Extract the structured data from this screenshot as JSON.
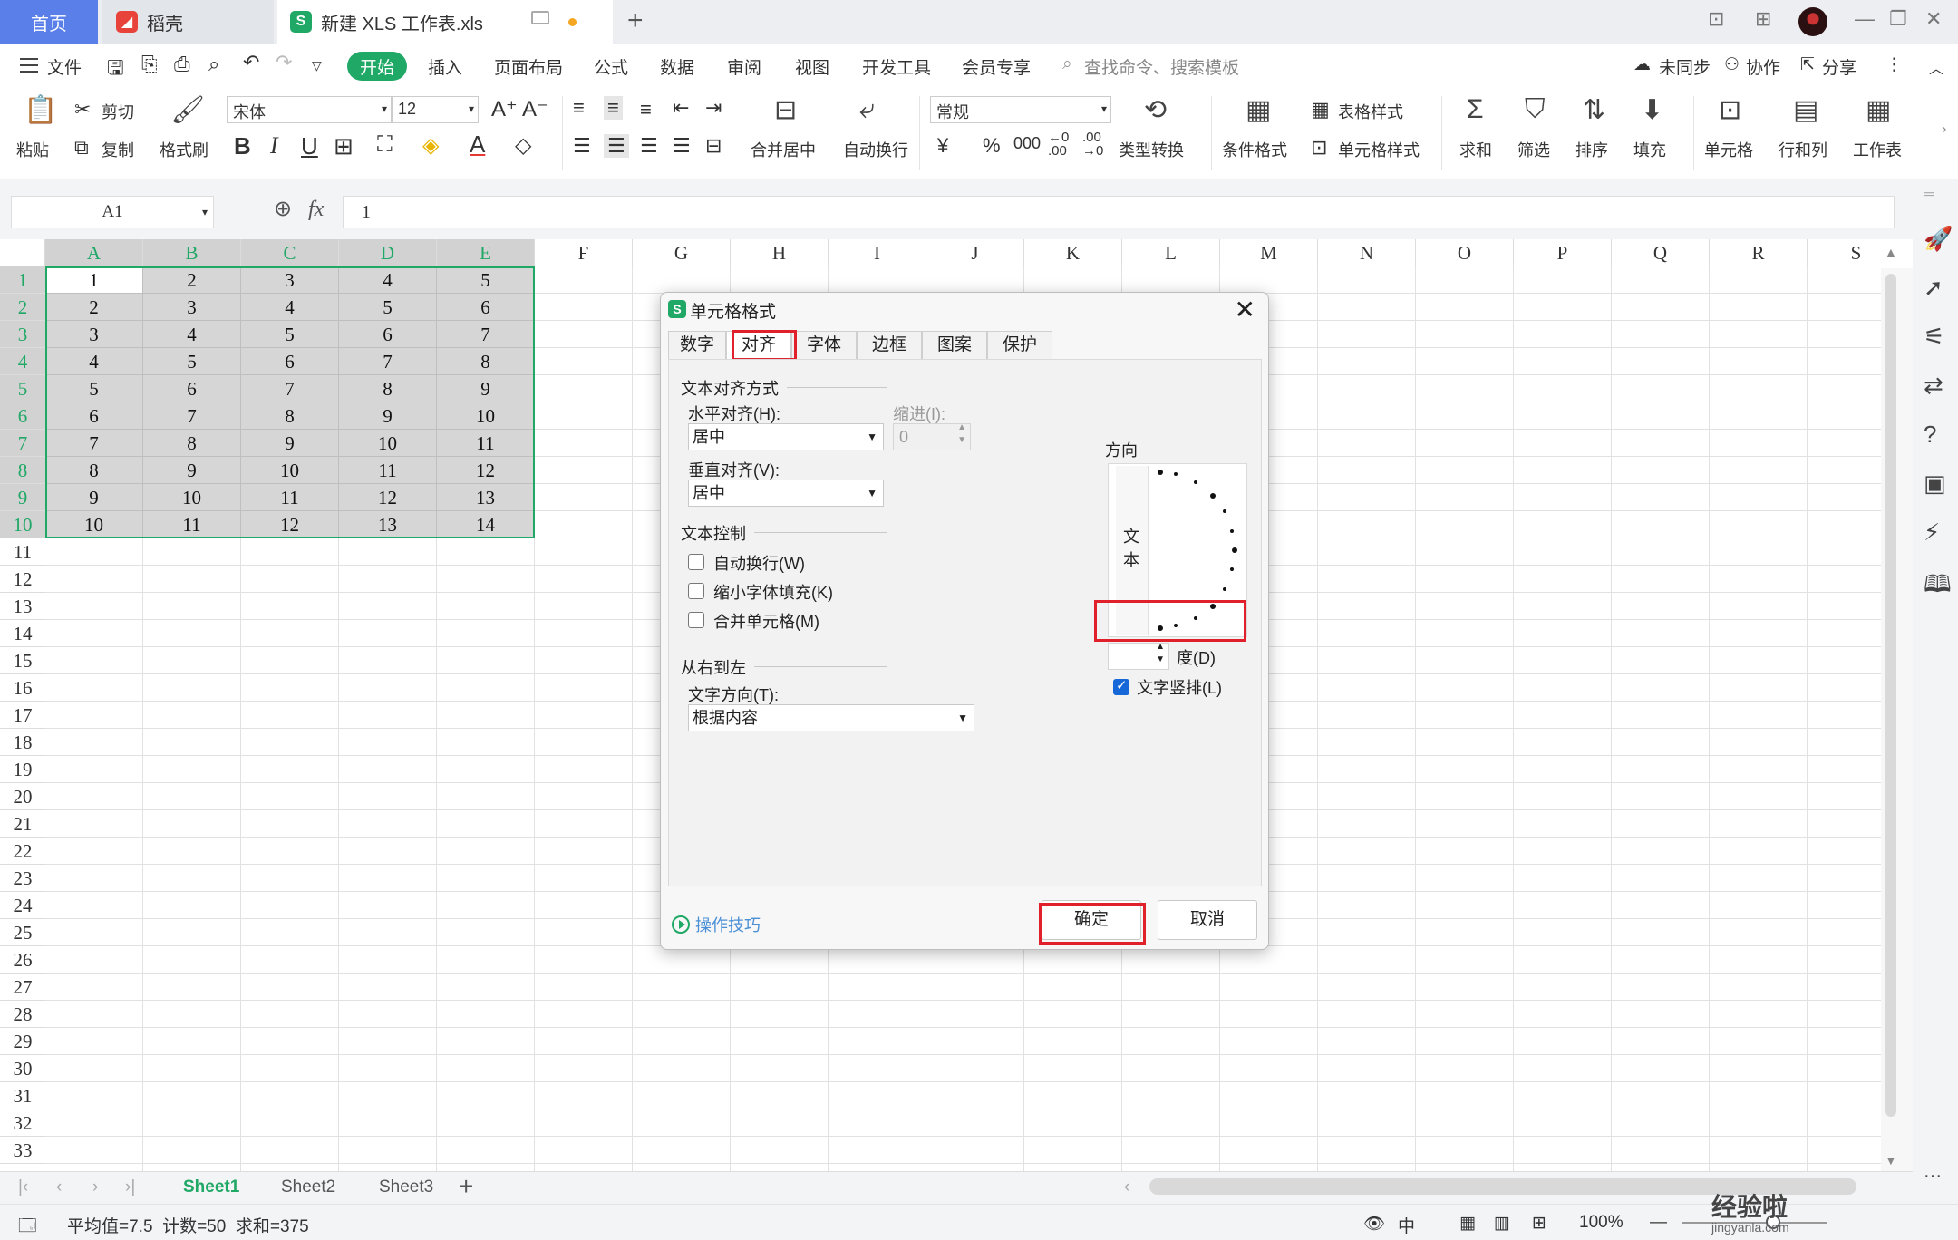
{
  "tabs": {
    "home": "首页",
    "daoke": "稻壳",
    "document": "新建 XLS 工作表.xls"
  },
  "menu": {
    "file": "文件",
    "start": "开始",
    "insert": "插入",
    "page_layout": "页面布局",
    "formula": "公式",
    "data": "数据",
    "review": "审阅",
    "view": "视图",
    "dev_tools": "开发工具",
    "member": "会员专享",
    "search_placeholder": "查找命令、搜索模板",
    "unsynced": "未同步",
    "collaborate": "协作",
    "share": "分享"
  },
  "ribbon": {
    "paste": "粘贴",
    "cut": "剪切",
    "copy": "复制",
    "format_painter": "格式刷",
    "font_name": "宋体",
    "font_size": "12",
    "merge_center": "合并居中",
    "wrap_text": "自动换行",
    "number_format": "常规",
    "type_convert": "类型转换",
    "cond_format": "条件格式",
    "table_style": "表格样式",
    "cell_style": "单元格样式",
    "sum": "求和",
    "filter": "筛选",
    "sort": "排序",
    "fill": "填充",
    "cell": "单元格",
    "row_col": "行和列",
    "worksheet": "工作表"
  },
  "formula_bar": {
    "name_box": "A1",
    "fx": "fx",
    "value": "1"
  },
  "grid": {
    "columns": [
      "A",
      "B",
      "C",
      "D",
      "E",
      "F",
      "G",
      "H",
      "I",
      "J",
      "K",
      "L",
      "M",
      "N",
      "O",
      "P",
      "Q",
      "R",
      "S"
    ],
    "rows": [
      "1",
      "2",
      "3",
      "4",
      "5",
      "6",
      "7",
      "8",
      "9",
      "10",
      "11",
      "12",
      "13",
      "14",
      "15",
      "16",
      "17",
      "18",
      "19",
      "20",
      "21",
      "22",
      "23",
      "24",
      "25",
      "26",
      "27",
      "28",
      "29",
      "30",
      "31",
      "32",
      "33"
    ],
    "data": [
      [
        "1",
        "2",
        "3",
        "4",
        "5"
      ],
      [
        "2",
        "3",
        "4",
        "5",
        "6"
      ],
      [
        "3",
        "4",
        "5",
        "6",
        "7"
      ],
      [
        "4",
        "5",
        "6",
        "7",
        "8"
      ],
      [
        "5",
        "6",
        "7",
        "8",
        "9"
      ],
      [
        "6",
        "7",
        "8",
        "9",
        "10"
      ],
      [
        "7",
        "8",
        "9",
        "10",
        "11"
      ],
      [
        "8",
        "9",
        "10",
        "11",
        "12"
      ],
      [
        "9",
        "10",
        "11",
        "12",
        "13"
      ],
      [
        "10",
        "11",
        "12",
        "13",
        "14"
      ]
    ]
  },
  "sheets": [
    "Sheet1",
    "Sheet2",
    "Sheet3"
  ],
  "status": {
    "summary": "平均值=7.5  计数=50  求和=375",
    "zoom": "100%"
  },
  "dialog": {
    "title": "单元格格式",
    "tabs": [
      "数字",
      "对齐",
      "字体",
      "边框",
      "图案",
      "保护"
    ],
    "text_align_section": "文本对齐方式",
    "h_align_label": "水平对齐(H):",
    "h_align_value": "居中",
    "indent_label": "缩进(I):",
    "indent_value": "0",
    "v_align_label": "垂直对齐(V):",
    "v_align_value": "居中",
    "text_control_section": "文本控制",
    "wrap": "自动换行(W)",
    "shrink": "缩小字体填充(K)",
    "merge": "合并单元格(M)",
    "rtl_section": "从右到左",
    "text_dir_label": "文字方向(T):",
    "text_dir_value": "根据内容",
    "orientation_section": "方向",
    "orientation_text_1": "文",
    "orientation_text_2": "本",
    "degree_label": "度(D)",
    "vertical_text": "文字竖排(L)",
    "tips": "操作技巧",
    "ok": "确定",
    "cancel": "取消"
  },
  "watermark": {
    "main": "经验啦",
    "sub": "jingyanla.com"
  },
  "colors": {
    "accent_green": "#20a866",
    "home_tab_blue": "#5b7fe8",
    "highlight_red": "#e0202a",
    "checkbox_blue": "#1668d8"
  }
}
